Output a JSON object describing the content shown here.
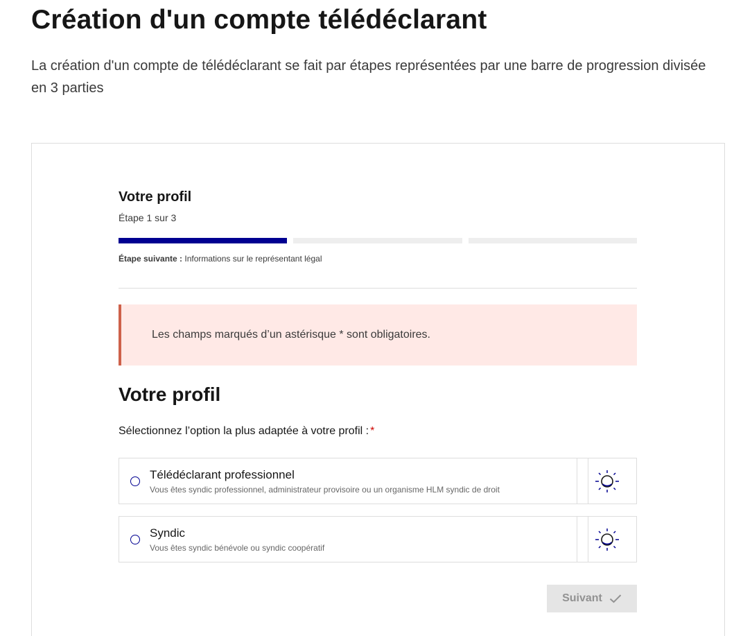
{
  "header": {
    "title": "Création d'un compte télédéclarant",
    "intro": "La création d'un compte de télédéclarant se fait par étapes représentées par une barre de progression divisée en 3 parties"
  },
  "stepper": {
    "title": "Votre profil",
    "state": "Étape 1 sur 3",
    "current_step": 1,
    "total_steps": 3,
    "next_label": "Étape suivante :",
    "next_value": "Informations sur le représentant légal",
    "active_color": "#000091"
  },
  "alert": {
    "text": "Les champs marqués d’un astérisque * sont obligatoires."
  },
  "form": {
    "section_title": "Votre profil",
    "legend": "Sélectionnez l’option la plus adaptée à votre profil :",
    "required_mark": "*",
    "options": [
      {
        "label": "Télédéclarant professionnel",
        "hint": "Vous êtes syndic professionnel, administrateur provisoire ou un organisme HLM syndic de droit",
        "icon": "sun-icon",
        "checked": false
      },
      {
        "label": "Syndic",
        "hint": "Vous êtes syndic bénévole ou syndic coopératif",
        "icon": "sun-icon",
        "checked": false
      }
    ],
    "submit_label": "Suivant",
    "submit_icon": "check-icon",
    "submit_disabled": true
  }
}
